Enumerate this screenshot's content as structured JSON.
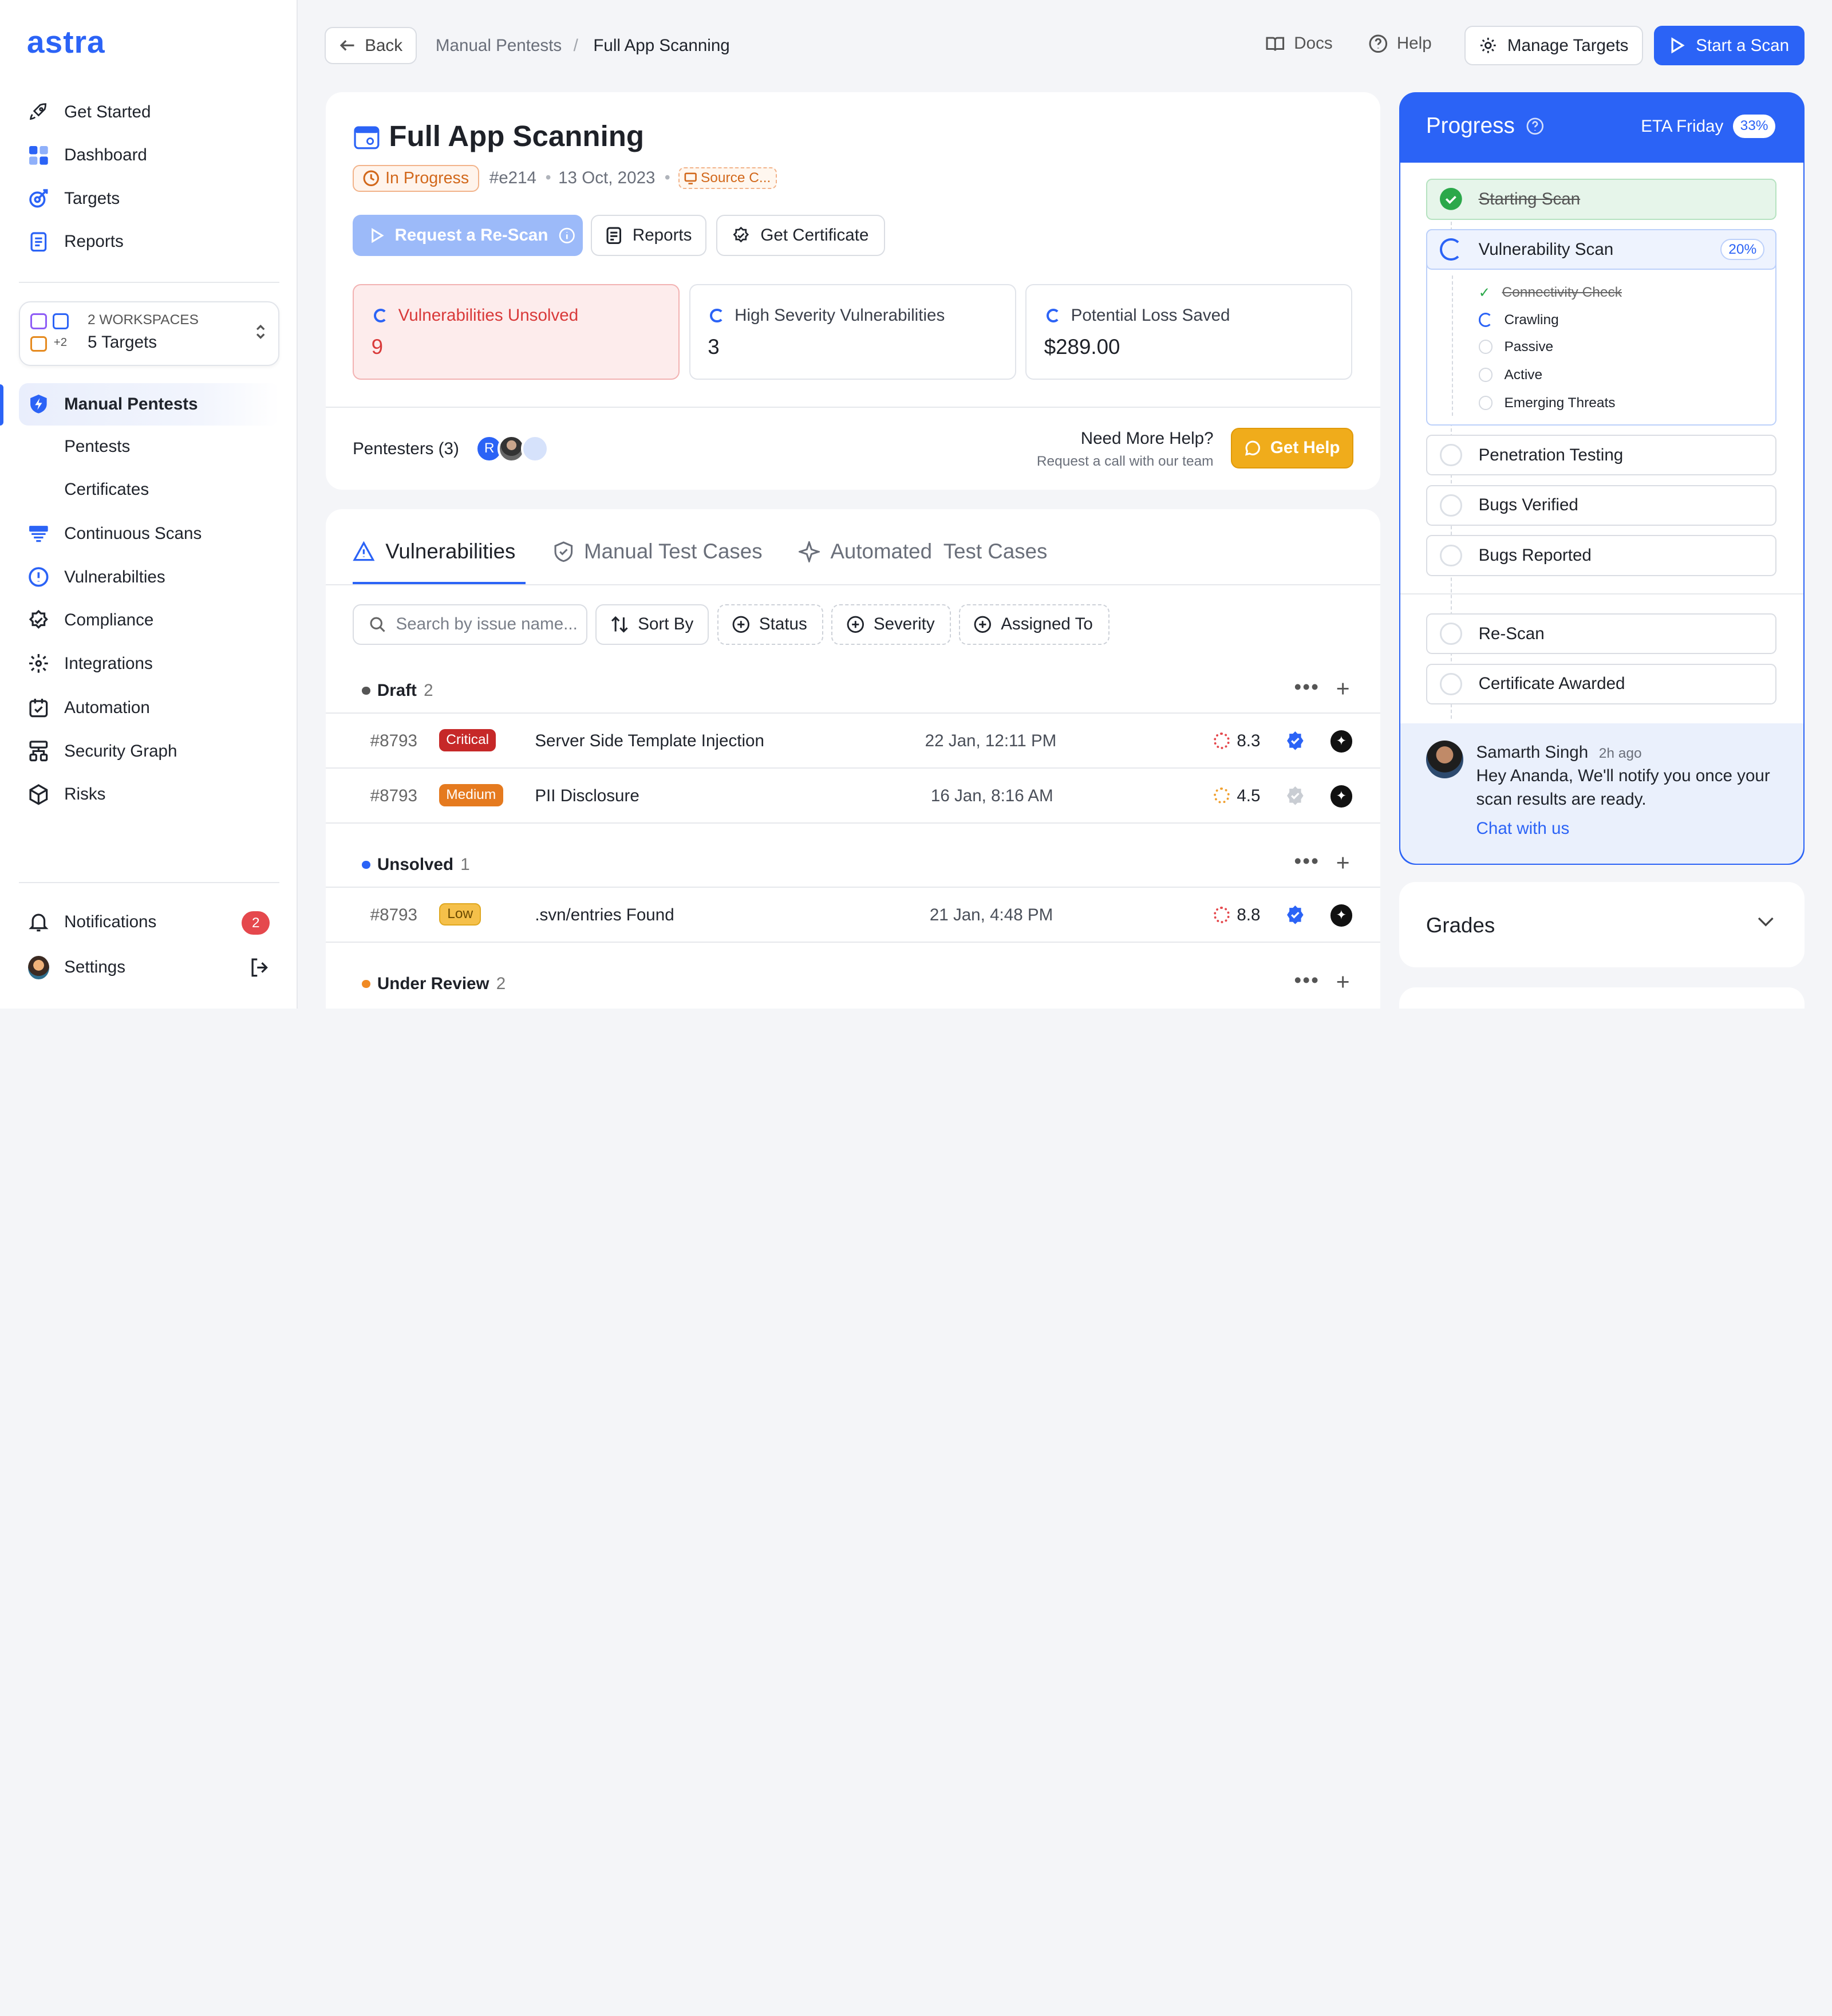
{
  "brand": {
    "logo": "astra",
    "accent": "#2B63F6"
  },
  "sidebar": {
    "nav": [
      {
        "label": "Get Started",
        "icon": "rocket-icon"
      },
      {
        "label": "Dashboard",
        "icon": "dashboard-icon"
      },
      {
        "label": "Targets",
        "icon": "target-icon"
      },
      {
        "label": "Reports",
        "icon": "report-icon"
      }
    ],
    "workspace": {
      "line1": "2 WORKSPACES",
      "line2": "5 Targets",
      "extra": "+2"
    },
    "section": [
      {
        "label": "Manual Pentests",
        "icon": "shield-bolt-icon",
        "active": true
      },
      {
        "label": "Pentests"
      },
      {
        "label": "Certificates"
      },
      {
        "label": "Continuous Scans",
        "icon": "scan-icon"
      },
      {
        "label": "Vulnerabilties",
        "icon": "alert-circle-icon"
      },
      {
        "label": "Compliance",
        "icon": "badge-check-icon"
      },
      {
        "label": "Integrations",
        "icon": "integrations-icon"
      },
      {
        "label": "Automation",
        "icon": "calendar-icon"
      },
      {
        "label": "Security Graph",
        "icon": "graph-icon"
      },
      {
        "label": "Risks",
        "icon": "cube-icon"
      }
    ],
    "notifications": {
      "label": "Notifications",
      "count": "2"
    },
    "settings": {
      "label": "Settings"
    }
  },
  "topbar": {
    "back": "Back",
    "crumb1": "Manual Pentests",
    "sep": "/",
    "crumb2": "Full App Scanning",
    "docs": "Docs",
    "help": "Help",
    "manage": "Manage Targets",
    "start": "Start a Scan"
  },
  "scan": {
    "title": "Full App Scanning",
    "status": "In Progress",
    "id": "#e214",
    "date": "13 Oct, 2023",
    "source": "Source C...",
    "rescan": "Request a Re-Scan",
    "reports": "Reports",
    "certificate": "Get Certificate"
  },
  "stats": [
    {
      "label": "Vulnerabilities Unsolved",
      "value": "9"
    },
    {
      "label": "High Severity Vulnerabilities",
      "value": "3"
    },
    {
      "label": "Potential Loss Saved",
      "value": "$289.00"
    }
  ],
  "pentesters": {
    "label": "Pentesters (3)",
    "avatar1": "R",
    "help_title": "Need More Help?",
    "help_sub": "Request a call with our team",
    "help_btn": "Get Help"
  },
  "tabs": [
    {
      "label": "Vulnerabilities",
      "active": true
    },
    {
      "label": "Manual Test Cases"
    },
    {
      "label": "Automated  Test Cases"
    }
  ],
  "filters": {
    "search_placeholder": "Search by issue name...",
    "sort": "Sort By",
    "status": "Status",
    "severity": "Severity",
    "assigned": "Assigned To"
  },
  "groups": [
    {
      "name": "Draft",
      "count": "2",
      "color": "#555555",
      "rows": [
        {
          "id": "#8793",
          "severity": "Critical",
          "title": "Server Side Template Injection",
          "date": "22 Jan, 12:11 PM",
          "score": "8.3",
          "verified": true
        },
        {
          "id": "#8793",
          "severity": "Medium",
          "title": "PII Disclosure",
          "date": "16 Jan, 8:16 AM",
          "score": "4.5",
          "verified": false
        }
      ]
    },
    {
      "name": "Unsolved",
      "count": "1",
      "color": "#2B63F6",
      "rows": [
        {
          "id": "#8793",
          "severity": "Low",
          "title": ".svn/entries Found",
          "date": "21 Jan, 4:48 PM",
          "score": "8.8",
          "verified": true
        }
      ]
    },
    {
      "name": "Under Review",
      "count": "2",
      "color": "#F08A24",
      "rows": []
    }
  ],
  "progress": {
    "title": "Progress",
    "eta": "ETA Friday",
    "pct": "33%",
    "steps": [
      {
        "label": "Starting Scan",
        "state": "done"
      },
      {
        "label": "Vulnerability Scan",
        "state": "active",
        "pct": "20%"
      },
      {
        "label": "Penetration Testing"
      },
      {
        "label": "Bugs Verified"
      },
      {
        "label": "Bugs Reported"
      },
      {
        "label": "Re-Scan"
      },
      {
        "label": "Certificate Awarded"
      }
    ],
    "substeps": [
      {
        "label": "Connectivity Check",
        "state": "done"
      },
      {
        "label": "Crawling",
        "state": "active"
      },
      {
        "label": "Passive"
      },
      {
        "label": "Active"
      },
      {
        "label": "Emerging Threats"
      }
    ]
  },
  "chat": {
    "name": "Samarth Singh",
    "time": "2h ago",
    "message_l1": "Hey Ananda, We'll notify you once your",
    "message_l2": "scan results are ready.",
    "link": "Chat with us"
  },
  "grades": {
    "title": "Grades"
  }
}
